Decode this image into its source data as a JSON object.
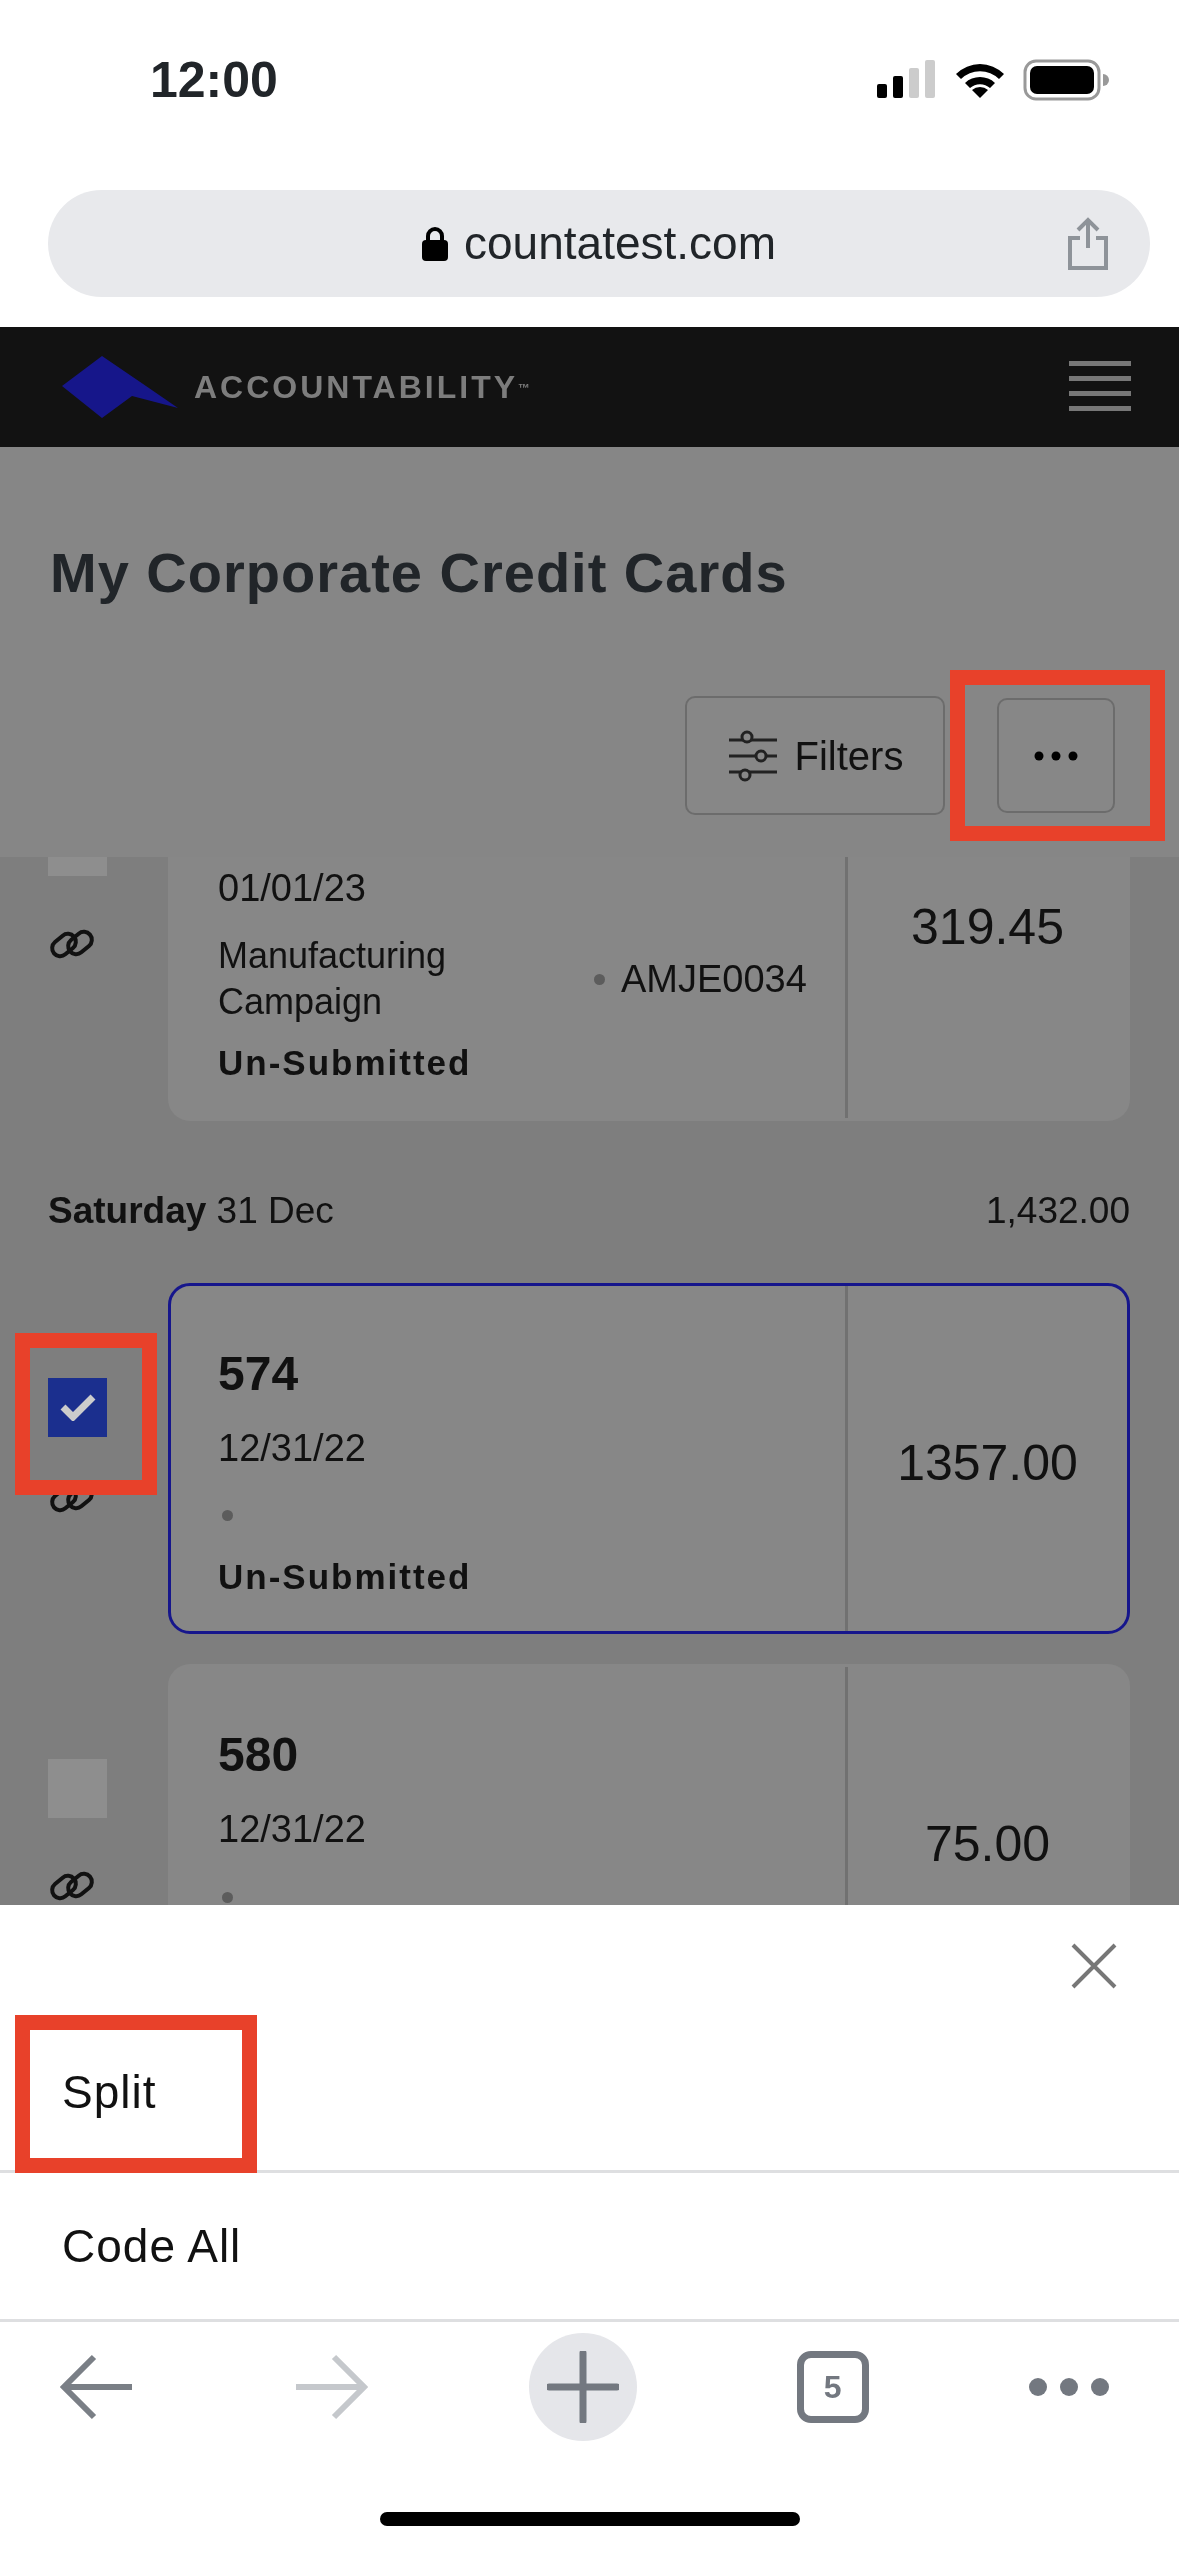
{
  "status_bar": {
    "time": "12:00"
  },
  "browser": {
    "url": "countatest.com"
  },
  "app_bar": {
    "brand": "ACCOUNTABILITY$^{™}$"
  },
  "page": {
    "title": "My Corporate Credit Cards",
    "filters_label": "Filters",
    "more_highlighted": true
  },
  "list": [
    {
      "kind": "card",
      "date": "01/01/23",
      "description": "Manufacturing Campaign",
      "code": "AMJE0034",
      "status": "Un-Submitted",
      "amount": "319.45",
      "checked": false,
      "selected": false,
      "highlighted": false
    },
    {
      "kind": "day",
      "label": "**Saturday** 31 Dec",
      "total": "1,432.00"
    },
    {
      "kind": "card",
      "number": "574",
      "date": "12/31/22",
      "status": "Un-Submitted",
      "amount": "1357.00",
      "checked": true,
      "selected": true,
      "highlighted": true
    },
    {
      "kind": "card",
      "number": "580",
      "date": "12/31/22",
      "amount": "75.00",
      "checked": false,
      "selected": false,
      "highlighted": false
    }
  ],
  "sheet": {
    "items": [
      {
        "label": "Split",
        "highlighted": true
      },
      {
        "label": "Code All",
        "highlighted": false
      }
    ]
  },
  "toolbar": {
    "back_disabled": false,
    "forward_disabled": true,
    "tab_count": "5"
  }
}
